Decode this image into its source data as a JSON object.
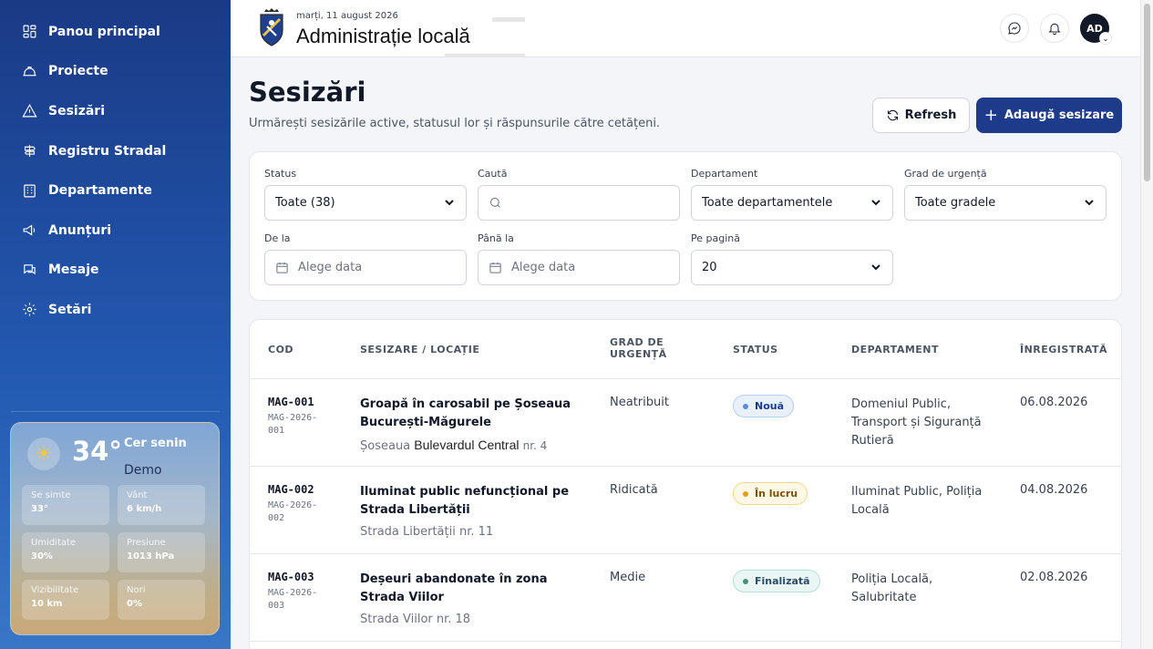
{
  "sidebar": {
    "items": [
      {
        "label": "Panou principal",
        "icon": "dashboard-icon"
      },
      {
        "label": "Proiecte",
        "icon": "hardhat-icon"
      },
      {
        "label": "Sesizări",
        "icon": "warning-icon"
      },
      {
        "label": "Registru Stradal",
        "icon": "signpost-icon"
      },
      {
        "label": "Departamente",
        "icon": "building-icon"
      },
      {
        "label": "Anunțuri",
        "icon": "megaphone-icon"
      },
      {
        "label": "Mesaje",
        "icon": "chat-icon"
      },
      {
        "label": "Setări",
        "icon": "gear-icon"
      }
    ],
    "weather": {
      "temp": "34°",
      "condition": "Cer senin",
      "demo": "Demo",
      "stats": [
        {
          "label": "Se simte",
          "value": "33°"
        },
        {
          "label": "Vânt",
          "value": "6 km/h"
        },
        {
          "label": "Umiditate",
          "value": "30%"
        },
        {
          "label": "Presiune",
          "value": "1013 hPa"
        },
        {
          "label": "Vizibilitate",
          "value": "10 km"
        },
        {
          "label": "Nori",
          "value": "0%"
        }
      ]
    }
  },
  "header": {
    "date": "marți, 11 august 2026",
    "title": "Administrație locală",
    "avatar_initials": "AD"
  },
  "main": {
    "title": "Sesizări",
    "subtitle": "Urmărești sesizările active, statusul lor și răspunsurile către cetățeni.",
    "refresh_label": "Refresh",
    "add_label": "Adaugă sesizare",
    "filters": {
      "status_label": "Status",
      "status_value": "Toate (38)",
      "search_label": "Caută",
      "dept_label": "Departament",
      "dept_value": "Toate departamentele",
      "urgency_label": "Grad de urgență",
      "urgency_value": "Toate gradele",
      "from_label": "De la",
      "from_placeholder": "Alege data",
      "to_label": "Până la",
      "to_placeholder": "Alege data",
      "perpage_label": "Pe pagină",
      "perpage_value": "20"
    },
    "table": {
      "headers": {
        "code": "COD",
        "issue": "SESIZARE / LOCAȚIE",
        "urgency_1": "GRAD DE",
        "urgency_2": "URGENȚĂ",
        "status": "STATUS",
        "dept": "DEPARTAMENT",
        "registered": "ÎNREGISTRATĂ"
      },
      "rows": [
        {
          "code": "MAG-001",
          "sub": "MAG-2026-001",
          "title": "Groapă în carosabil pe Șoseaua București-Măgurele",
          "loc_a": "Șoseaua",
          "loc_b": "Bulevardul Central",
          "loc_c": "nr. 4",
          "urgency": "Neatribuit",
          "status": "Nouă",
          "status_bg": "#e8f0fb",
          "status_border": "#b9cfee",
          "status_fg": "#1e3a8a",
          "status_dot": "#5b8bd6",
          "dept": "Domeniul Public, Transport și Siguranță Rutieră",
          "date": "06.08.2026"
        },
        {
          "code": "MAG-002",
          "sub": "MAG-2026-002",
          "title": "Iluminat public nefuncțional pe Strada Libertății",
          "loc": "Strada Libertății nr. 11",
          "urgency": "Ridicată",
          "status": "În lucru",
          "status_bg": "#fff8e6",
          "status_border": "#f3d98c",
          "status_fg": "#7a5200",
          "status_dot": "#e3a11a",
          "dept": "Iluminat Public, Poliția Locală",
          "date": "04.08.2026"
        },
        {
          "code": "MAG-003",
          "sub": "MAG-2026-003",
          "title": "Deșeuri abandonate în zona Strada Viilor",
          "loc": "Strada Viilor nr. 18",
          "urgency": "Medie",
          "status": "Finalizată",
          "status_bg": "#eaf6f3",
          "status_border": "#b7e0d4",
          "status_fg": "#2c4d6b",
          "status_dot": "#4a8d82",
          "dept": "Poliția Locală, Salubritate",
          "date": "02.08.2026"
        }
      ]
    }
  }
}
